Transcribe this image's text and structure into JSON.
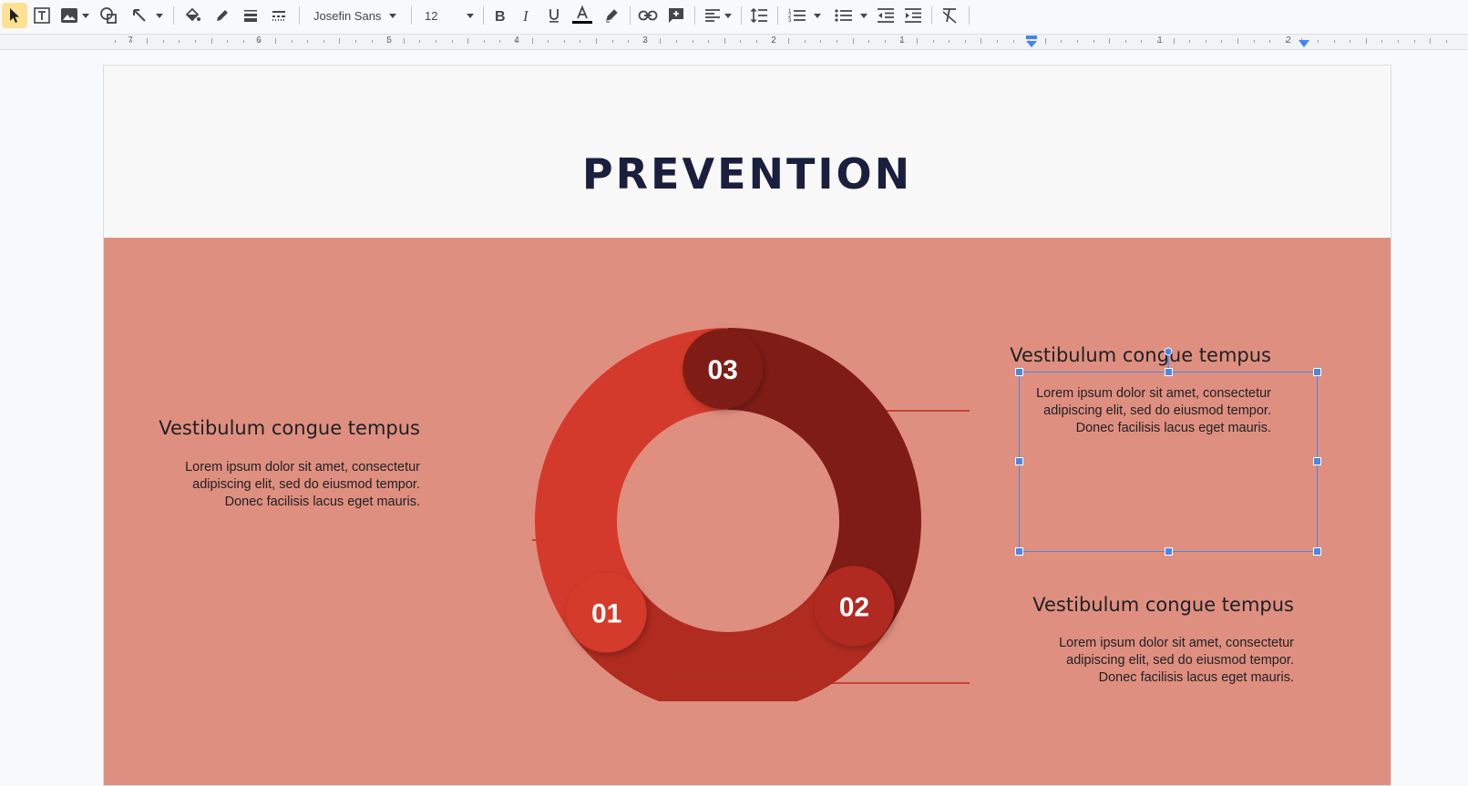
{
  "toolbar": {
    "font_name": "Josefin Sans",
    "font_size": "12",
    "text_color_underline": "#000000",
    "icons": [
      "select-icon",
      "text-box-icon",
      "image-icon",
      "shape-icon",
      "line-icon",
      "fill-color-icon",
      "border-color-icon",
      "border-weight-icon",
      "border-dash-icon",
      "bold-icon",
      "italic-icon",
      "underline-icon",
      "text-color-icon",
      "highlight-icon",
      "link-icon",
      "comment-icon",
      "align-icon",
      "line-spacing-icon",
      "numbered-list-icon",
      "bulleted-list-icon",
      "decrease-indent-icon",
      "increase-indent-icon",
      "clear-formatting-icon"
    ]
  },
  "ruler": {
    "left_numbers": [
      "7",
      "6",
      "5",
      "4",
      "3",
      "2",
      "1"
    ],
    "right_numbers": [
      "1",
      "2"
    ]
  },
  "slide": {
    "title": "PREVENTION",
    "band_color": "#df8f80",
    "segments": [
      {
        "number": "01",
        "color": "#d43a2b"
      },
      {
        "number": "02",
        "color": "#b02b20"
      },
      {
        "number": "03",
        "color": "#801c16"
      }
    ],
    "blocks": [
      {
        "heading": "Vestibulum congue tempus",
        "body": "Lorem ipsum dolor sit amet, consectetur\nadipiscing elit, sed do eiusmod tempor.\nDonec facilisis lacus eget mauris."
      },
      {
        "heading": "Vestibulum congue tempus",
        "body": "Lorem ipsum dolor sit amet, consectetur\nadipiscing elit, sed do eiusmod tempor.\nDonec facilisis lacus eget mauris."
      },
      {
        "heading": "Vestibulum congue tempus",
        "body": "Lorem ipsum dolor sit amet, consectetur\nadipiscing elit, sed do eiusmod tempor.\nDonec facilisis lacus eget mauris."
      }
    ]
  }
}
